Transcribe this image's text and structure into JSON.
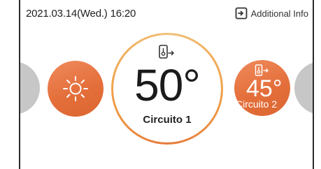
{
  "header": {
    "datetime": "2021.03.14(Wed.) 16:20",
    "info_button_label": "Additional Info"
  },
  "mode": {
    "icon": "sun-icon"
  },
  "circuit_main": {
    "temperature": "50°",
    "label": "Circuito 1",
    "icon": "water-heater-output-icon"
  },
  "circuit_secondary": {
    "temperature": "45°",
    "label": "Circuito 2",
    "icon": "water-heater-output-icon"
  },
  "colors": {
    "accent_orange": "#e46f3b",
    "ring_gradient_light": "#f1c07a",
    "ghost_gray": "#c7c7c7"
  }
}
